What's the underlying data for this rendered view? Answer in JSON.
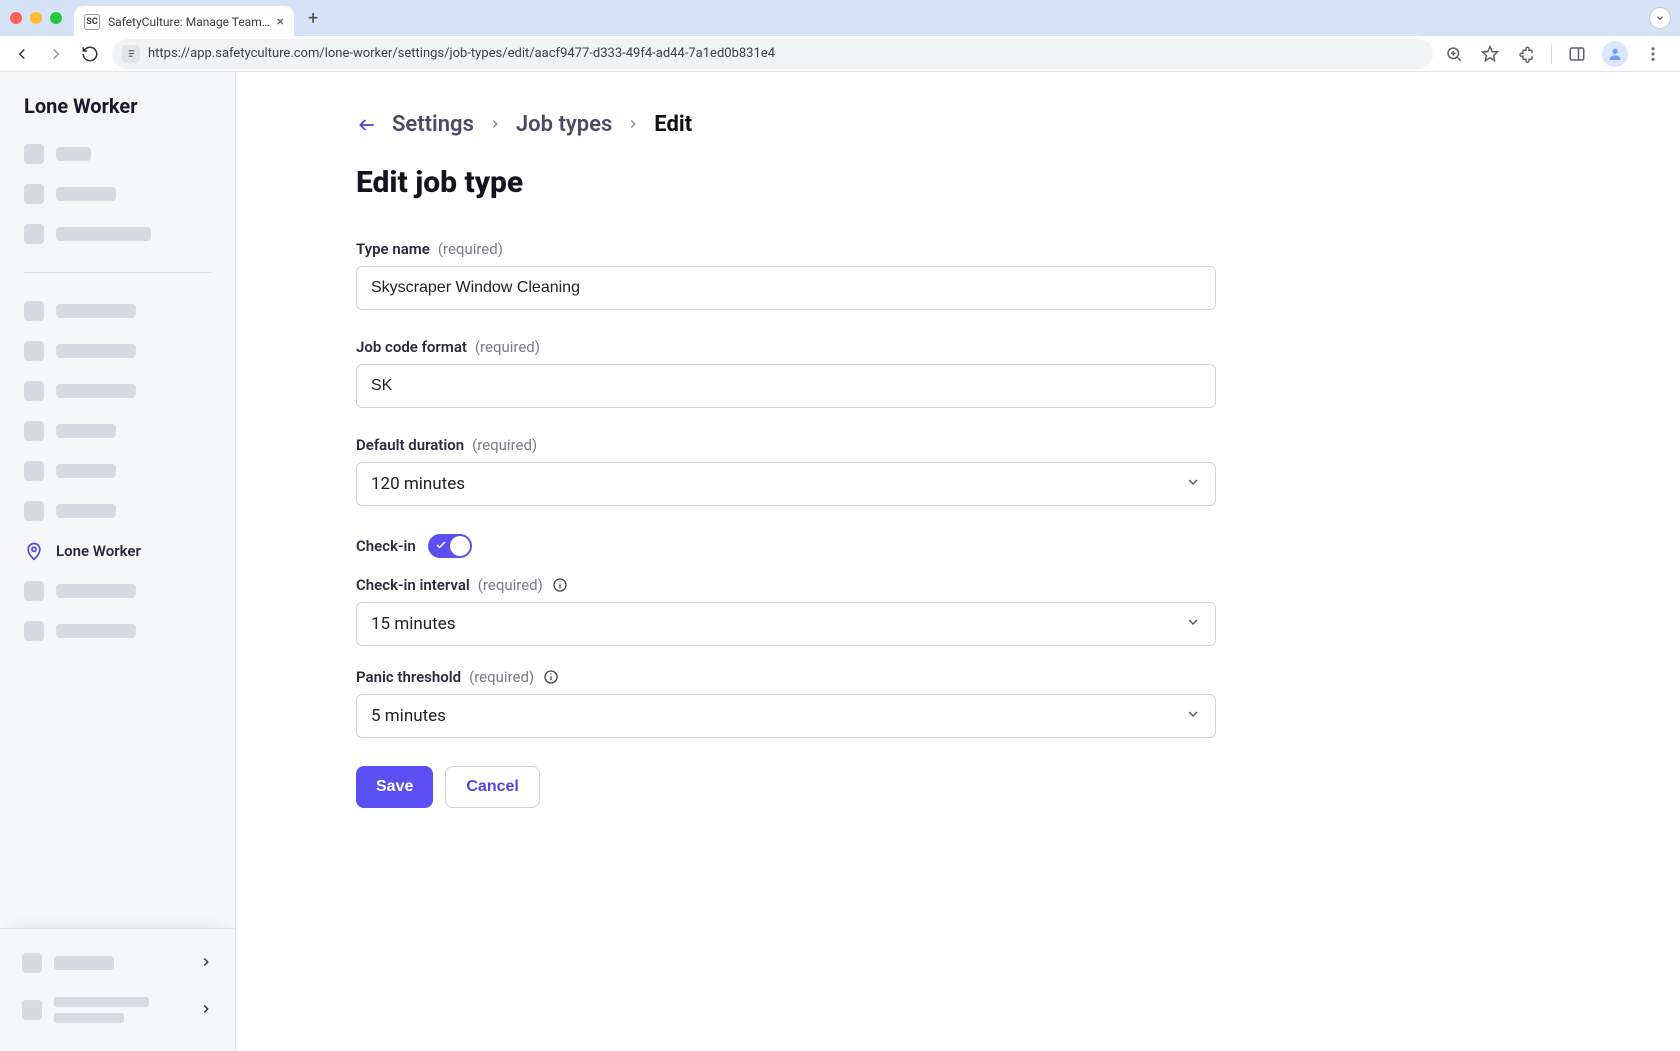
{
  "browser": {
    "tab_title": "SafetyCulture: Manage Teams and...",
    "url": "https://app.safetyculture.com/lone-worker/settings/job-types/edit/aacf9477-d333-49f4-ad44-7a1ed0b831e4"
  },
  "sidebar": {
    "title": "Lone Worker",
    "active_item_label": "Lone Worker"
  },
  "breadcrumb": {
    "items": [
      "Settings",
      "Job types",
      "Edit"
    ]
  },
  "page": {
    "heading": "Edit job type"
  },
  "form": {
    "type_name": {
      "label": "Type name",
      "required": "(required)",
      "value": "Skyscraper Window Cleaning"
    },
    "job_code_format": {
      "label": "Job code format",
      "required": "(required)",
      "value": "SK"
    },
    "default_duration": {
      "label": "Default duration",
      "required": "(required)",
      "value": "120 minutes"
    },
    "check_in": {
      "label": "Check-in",
      "enabled": true
    },
    "check_in_interval": {
      "label": "Check-in interval",
      "required": "(required)",
      "value": "15 minutes"
    },
    "panic_threshold": {
      "label": "Panic threshold",
      "required": "(required)",
      "value": "5 minutes"
    },
    "actions": {
      "save": "Save",
      "cancel": "Cancel"
    }
  }
}
